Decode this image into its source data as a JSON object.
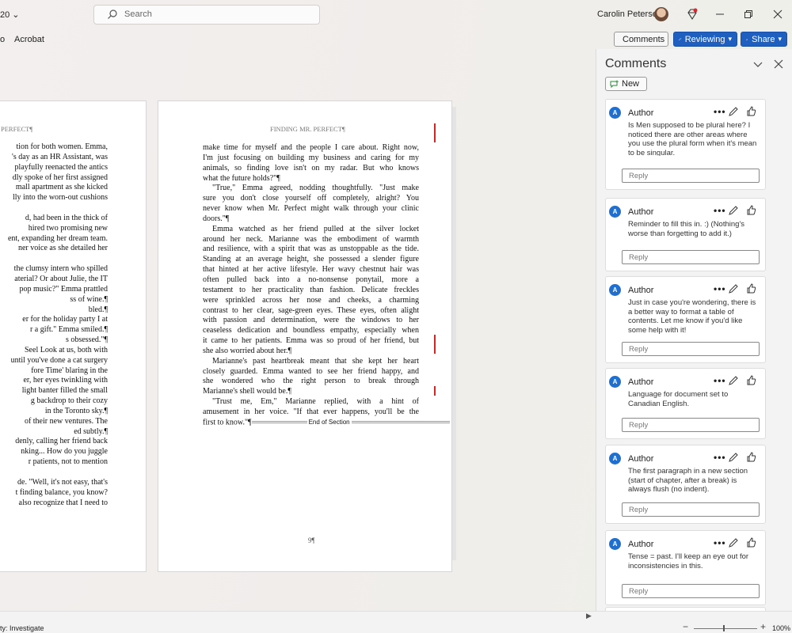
{
  "titlebar": {
    "version_fragment": "20",
    "search_placeholder": "Search",
    "user_name": "Carolin Petersen"
  },
  "ribbon": {
    "fragment": "o",
    "acrobat": "Acrobat",
    "comments_label": "Comments",
    "reviewing_label": "Reviewing",
    "share_label": "Share"
  },
  "document": {
    "left_header": "PERFECT¶",
    "left_lines": [
      "tion for both women. Emma,",
      "'s day as an HR Assistant, was",
      "playfully reenacted the antics",
      "dly spoke of her first assigned",
      "mall apartment as she kicked",
      "lly into the worn-out cushions",
      "",
      "d, had been in the thick of",
      "hired two promising new",
      "ent, expanding her dream team.",
      "ner voice as she detailed her",
      "",
      "the clumsy intern who spilled",
      "aterial? Or about Julie, the IT",
      "pop music?\" Emma prattled",
      "ss of wine.¶",
      "bled.¶",
      "er for the holiday party I at",
      "r a gift.\" Emma smiled.¶",
      "s obsessed.\"¶",
      "Seel Look at us, both with",
      "until you've done a cat surgery",
      "fore Time' blaring in the",
      "er, her eyes twinkling with",
      "light banter filled the small",
      "g backdrop to their cozy",
      "in the Toronto sky.¶",
      "of their new ventures. The",
      "ed subtly.¶",
      "denly, calling her friend back",
      "nking... How do you juggle",
      "r patients, not to mention",
      "",
      "de. \"Well, it's not easy, that's",
      "t finding balance, you know?",
      "also recognize that I need to"
    ],
    "right_header": "FINDING MR. PERFECT¶",
    "right_paragraphs": [
      [
        "make time for myself and the people I care about. Right now,",
        "I'm just focusing on building my business and caring for my",
        "animals, so finding love isn't on my radar. But who knows",
        "what the future holds?\"¶"
      ],
      [
        "\"True,\" Emma agreed, nodding thoughtfully. \"Just make",
        "sure you don't close yourself off completely, alright? You",
        "never know when Mr. Perfect might walk through your clinic",
        "doors.\"¶"
      ],
      [
        "Emma watched as her friend pulled at the silver locket",
        "around her neck. Marianne was the embodiment of warmth",
        "and resilience, with a spirit that was as unstoppable as the tide.",
        "Standing at an average height, she possessed a slender figure",
        "that hinted at her active lifestyle. Her wavy chestnut hair was",
        "often pulled back into a no-nonsense ponytail, more a",
        "testament to her practicality than fashion. Delicate freckles",
        "were sprinkled across her nose and cheeks, a charming",
        "contrast to her clear, sage-green eyes. These eyes, often alight",
        "with passion and determination, were the windows to her",
        "ceaseless dedication and boundless empathy, especially when",
        "it came to her patients. Emma was so proud of her friend, but",
        "she also worried about her.¶"
      ],
      [
        "Marianne's past heartbreak meant that she kept her heart",
        "closely guarded. Emma wanted to see her friend happy, and",
        "she wondered who the right person to break through",
        "Marianne's shell would be.¶"
      ],
      [
        "\"Trust me, Em,\" Marianne replied, with a hint of",
        "amusement in her voice. \"If that ever happens, you'll be the"
      ]
    ],
    "last_line": "first to know.\"¶",
    "end_of_section": "End of Section",
    "page_number": "9¶"
  },
  "comments_panel": {
    "title": "Comments",
    "new_label": "New",
    "reply_placeholder": "Reply",
    "comments": [
      {
        "initial": "A",
        "author": "Author",
        "text": "Is Men supposed to be plural here? I noticed there are other areas where you use the plural form when it's mean to be singular."
      },
      {
        "initial": "A",
        "author": "Author",
        "text": "Reminder to fill this in. :) (Nothing's worse than forgetting to add it.)"
      },
      {
        "initial": "A",
        "author": "Author",
        "text": "Just in case you're wondering, there is a better way to format a table of contents. Let me know if you'd like some help with it!"
      },
      {
        "initial": "A",
        "author": "Author",
        "text": "Language for document set to Canadian English."
      },
      {
        "initial": "A",
        "author": "Author",
        "text": "The first paragraph in a new section (start of chapter, after a break) is always flush (no indent)."
      },
      {
        "initial": "A",
        "author": "Author",
        "text": "Tense = past. I'll keep an eye out for inconsistencies in this."
      }
    ]
  },
  "statusbar": {
    "status_text": "ty: Investigate",
    "zoom_level": "100%",
    "zoom_fraction": 0.5
  }
}
